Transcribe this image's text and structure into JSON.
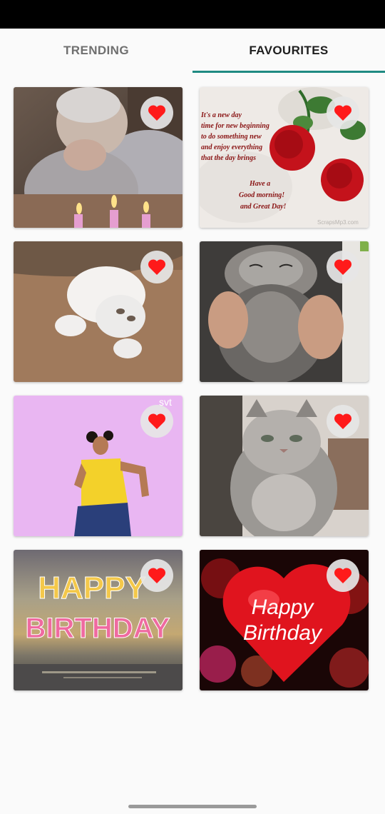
{
  "tabs": [
    {
      "label": "TRENDING",
      "active": false
    },
    {
      "label": "FAVOURITES",
      "active": true
    }
  ],
  "accent_color": "#1f8a82",
  "heart_color": "#ff1a1a",
  "favorite_icon": "heart-icon",
  "cards": [
    {
      "subject": "elderly woman with birthday candles",
      "favorited": true
    },
    {
      "subject": "good morning card with red roses",
      "favorited": true,
      "text_lines": [
        "It's a new day",
        "time for new beginning",
        "to do something new",
        "and enjoy everything",
        "that the day brings"
      ],
      "text_lines_2": [
        "Have a",
        "Good morning!",
        "and Great Day!"
      ],
      "watermark": "ScrapsMp3.com"
    },
    {
      "subject": "white cat rolling on floor",
      "favorited": true
    },
    {
      "subject": "grey cat having cheeks rubbed",
      "favorited": true
    },
    {
      "subject": "woman dancing on purple background",
      "favorited": true,
      "watermark": "svt"
    },
    {
      "subject": "fluffy grey cat",
      "favorited": true
    },
    {
      "subject": "happy birthday over sea sunset",
      "favorited": true,
      "text_lines": [
        "HAPPY",
        "BIRTHDAY"
      ]
    },
    {
      "subject": "red heart with fireworks",
      "favorited": true,
      "text_lines": [
        "Happy",
        "Birthday"
      ]
    }
  ]
}
